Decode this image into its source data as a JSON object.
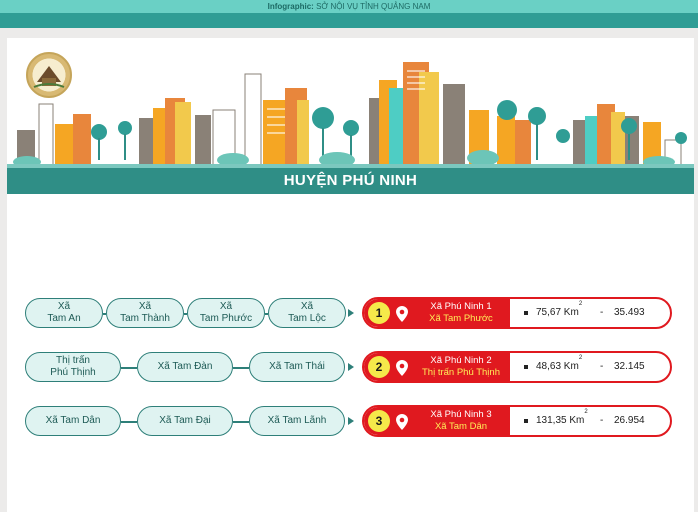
{
  "header": {
    "caption_prefix": "Infographic:",
    "caption_source": "SỞ NỘI VỤ TỈNH QUẢNG NAM"
  },
  "banner": {
    "title": "HUYỆN PHÚ NINH"
  },
  "rows": [
    {
      "communes": [
        {
          "line1": "Xã",
          "line2": "Tam An"
        },
        {
          "line1": "Xã",
          "line2": "Tam Thành"
        },
        {
          "line1": "Xã",
          "line2": "Tam Phước"
        },
        {
          "line1": "Xã",
          "line2": "Tam Lộc"
        }
      ],
      "result": {
        "number": "1",
        "new_name": "Xã Phú Ninh 1",
        "center": "Xã Tam Phước",
        "area": "75,67 Km",
        "area_sup": "2",
        "separator": "-",
        "population": "35.493 người"
      }
    },
    {
      "communes": [
        {
          "line1": "Thị trấn",
          "line2": "Phú Thịnh"
        },
        {
          "line1": "Xã Tam Đàn",
          "line2": ""
        },
        {
          "line1": "Xã Tam Thái",
          "line2": ""
        }
      ],
      "result": {
        "number": "2",
        "new_name": "Xã Phú Ninh 2",
        "center": "Thị trấn Phú Thịnh",
        "area": "48,63 Km",
        "area_sup": "2",
        "separator": "-",
        "population": "32.145 người"
      }
    },
    {
      "communes": [
        {
          "line1": "Xã Tam Dân",
          "line2": ""
        },
        {
          "line1": "Xã Tam Đại",
          "line2": ""
        },
        {
          "line1": "Xã Tam Lãnh",
          "line2": ""
        }
      ],
      "result": {
        "number": "3",
        "new_name": "Xã Phú Ninh 3",
        "center": "Xã Tam Dân",
        "area": "131,35 Km",
        "area_sup": "2",
        "separator": "-",
        "population": "26.954 người"
      }
    }
  ],
  "colors": {
    "teal": "#2f8e86",
    "pill_fill": "#dff3f1",
    "red": "#e0191f",
    "yellow": "#ffee58"
  },
  "icons": [
    "emblem-logo",
    "city-skyline-illustration",
    "map-pin-icon"
  ]
}
